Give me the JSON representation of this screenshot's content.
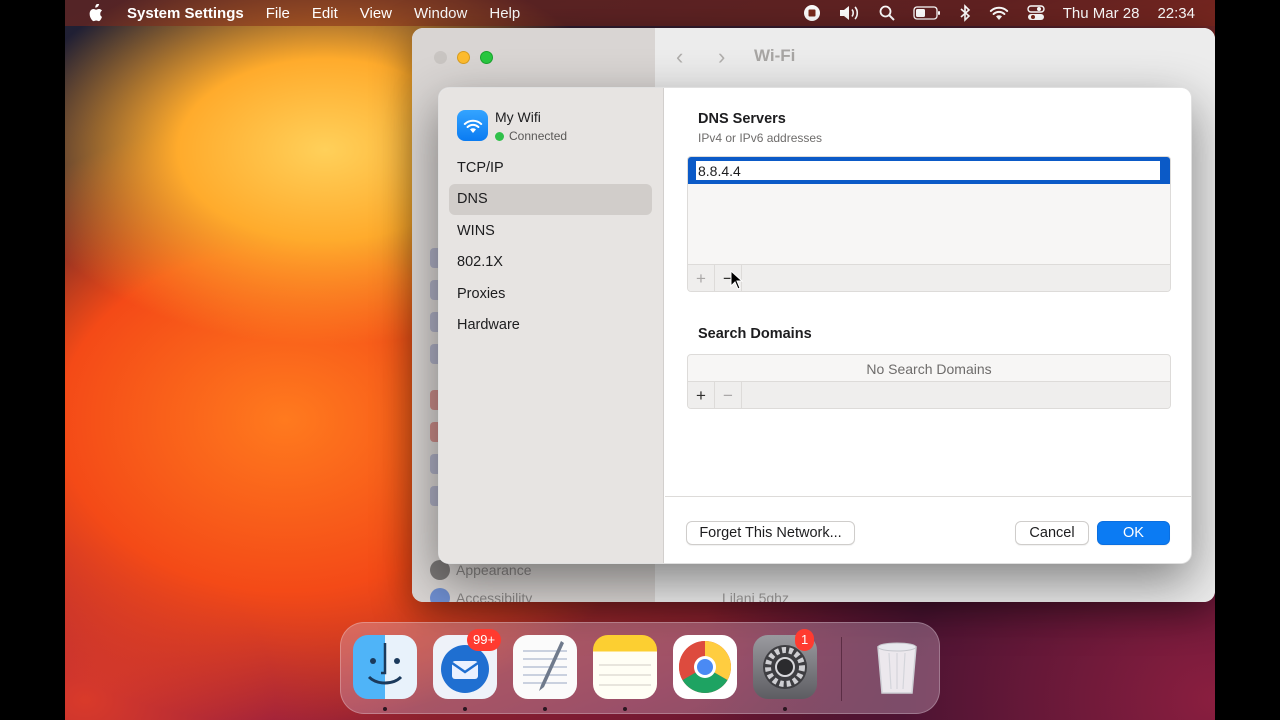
{
  "menubar": {
    "app_name": "System Settings",
    "menus": [
      "File",
      "Edit",
      "View",
      "Window",
      "Help"
    ],
    "date": "Thu Mar 28",
    "time": "22:34"
  },
  "settings_window": {
    "title": "Wi-Fi",
    "sidebar_appearance": "Appearance",
    "sidebar_accessibility": "Accessibility",
    "network_row": "Lilani 5ghz"
  },
  "dialog": {
    "network_name": "My Wifi",
    "network_status": "Connected",
    "nav": [
      "TCP/IP",
      "DNS",
      "WINS",
      "802.1X",
      "Proxies",
      "Hardware"
    ],
    "selected_nav": "DNS",
    "dns_title": "DNS Servers",
    "dns_subtitle": "IPv4 or IPv6 addresses",
    "dns_value": "8.8.4.4",
    "add_symbol": "+",
    "remove_symbol": "−",
    "search_title": "Search Domains",
    "search_empty": "No Search Domains",
    "forget_label": "Forget This Network...",
    "cancel_label": "Cancel",
    "ok_label": "OK"
  },
  "dock": {
    "apps": [
      "finder-icon",
      "thunderbird-icon",
      "textedit-icon",
      "notes-icon",
      "chrome-icon",
      "system-settings-icon",
      "trash-icon"
    ],
    "thunderbird_badge": "99+",
    "settings_badge": "1"
  },
  "colors": {
    "accent": "#0b7bf3",
    "selection": "#0b5ac7",
    "status_green": "#30c04a",
    "badge_red": "#ff3b30"
  }
}
